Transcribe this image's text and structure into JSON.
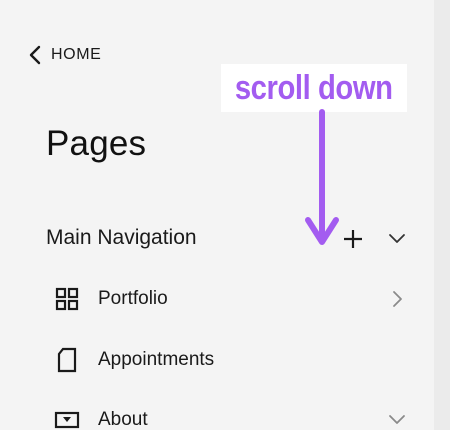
{
  "nav": {
    "back_label": "HOME",
    "back_icon": "chevron-left-icon"
  },
  "page": {
    "title": "Pages"
  },
  "section": {
    "title": "Main Navigation",
    "add_icon": "plus-icon",
    "collapse_icon": "chevron-down-icon"
  },
  "items": [
    {
      "label": "Portfolio",
      "icon": "grid-icon",
      "trailing_icon": "chevron-right-icon"
    },
    {
      "label": "Appointments",
      "icon": "page-icon"
    },
    {
      "label": "About",
      "icon": "dropdown-box-icon",
      "trailing_icon": "chevron-down-icon"
    }
  ],
  "annotation": {
    "text": "scroll down",
    "color": "#a35cf0"
  },
  "colors": {
    "panel_bg": "#f4f4f4",
    "text": "#1a1a1a",
    "muted_icon": "#8a8a8a",
    "accent": "#a35cf0"
  }
}
